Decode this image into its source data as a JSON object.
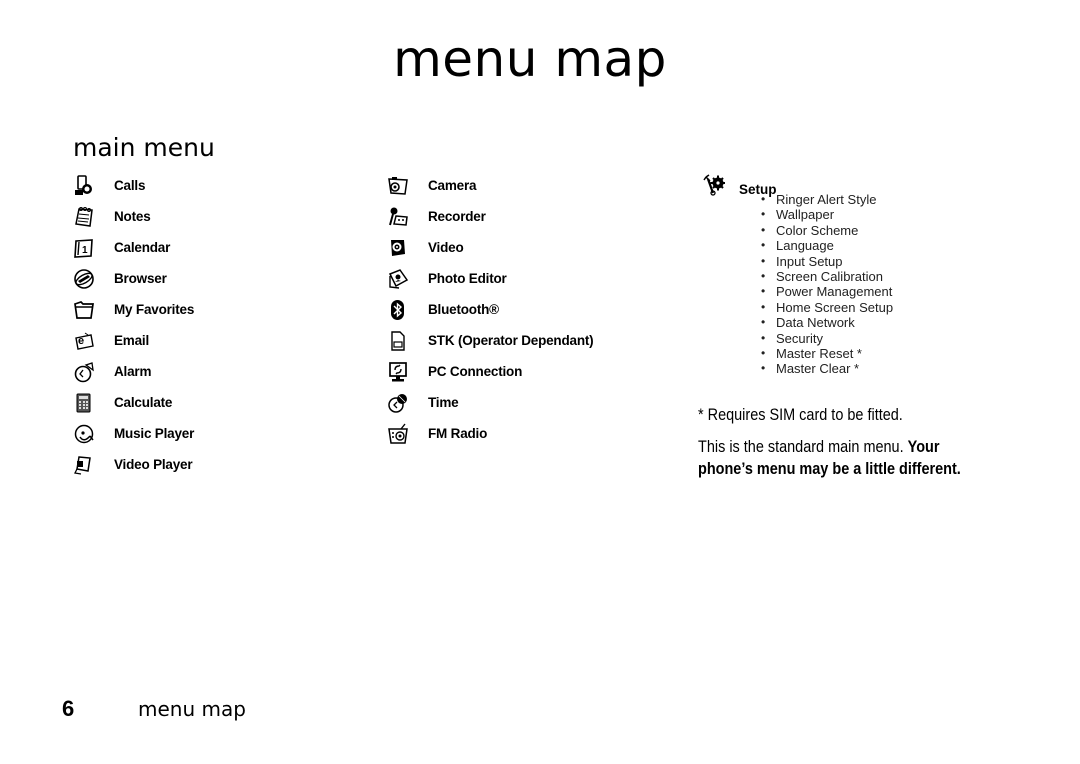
{
  "page": {
    "title": "menu map",
    "section_title": "main menu"
  },
  "column1": [
    {
      "label": "Calls",
      "icon": "calls-icon"
    },
    {
      "label": "Notes",
      "icon": "notes-icon"
    },
    {
      "label": "Calendar",
      "icon": "calendar-icon"
    },
    {
      "label": "Browser",
      "icon": "browser-icon"
    },
    {
      "label": "My Favorites",
      "icon": "folder-icon"
    },
    {
      "label": "Email",
      "icon": "email-icon"
    },
    {
      "label": "Alarm",
      "icon": "alarm-icon"
    },
    {
      "label": "Calculate",
      "icon": "calculator-icon"
    },
    {
      "label": "Music Player",
      "icon": "music-player-icon"
    },
    {
      "label": "Video Player",
      "icon": "video-player-icon"
    }
  ],
  "column2": [
    {
      "label": "Camera",
      "icon": "camera-icon"
    },
    {
      "label": "Recorder",
      "icon": "recorder-icon"
    },
    {
      "label": "Video",
      "icon": "video-icon"
    },
    {
      "label": "Photo Editor",
      "icon": "photo-editor-icon"
    },
    {
      "label": "Bluetooth®",
      "icon": "bluetooth-icon"
    },
    {
      "label": "STK (Operator Dependant)",
      "icon": "sim-card-icon"
    },
    {
      "label": "PC Connection",
      "icon": "pc-connection-icon"
    },
    {
      "label": "Time",
      "icon": "time-icon"
    },
    {
      "label": "FM Radio",
      "icon": "radio-icon"
    }
  ],
  "setup": {
    "label": "Setup",
    "icon": "setup-icon",
    "items": [
      "Ringer Alert Style",
      "Wallpaper",
      "Color Scheme",
      "Language",
      "Input Setup",
      "Screen Calibration",
      "Power Management",
      "Home Screen Setup",
      "Data Network",
      "Security",
      "Master Reset *",
      "Master Clear *"
    ]
  },
  "notes": {
    "sim_note": "* Requires SIM card to be fitted.",
    "standard_text": "This is the standard main menu.",
    "bold_text_line1": "Your",
    "bold_text_line2": "phone’s menu may be a little different."
  },
  "footer": {
    "page_number": "6",
    "section": "menu map"
  }
}
